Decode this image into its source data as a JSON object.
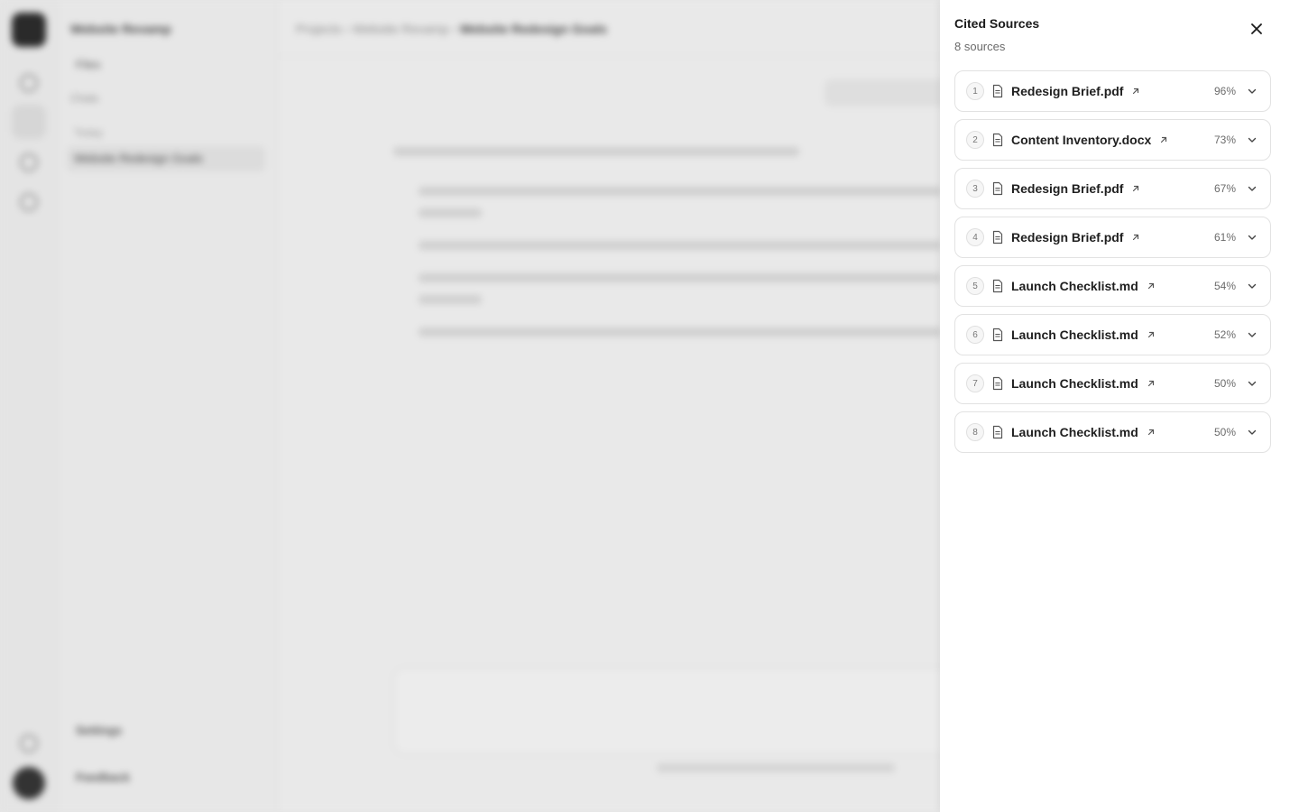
{
  "background": {
    "workspace_title": "Website Revamp",
    "files_label": "Files",
    "chats_label": "Chats",
    "today_label": "Today",
    "current_chat": "Website Redesign Goals",
    "settings_label": "Settings",
    "feedback_label": "Feedback",
    "breadcrumb": [
      "Projects",
      "Website Revamp",
      "Website Redesign Goals"
    ]
  },
  "drawer": {
    "title": "Cited Sources",
    "count": "8 sources",
    "sources": [
      {
        "index": "1",
        "name": "Redesign Brief.pdf",
        "score": "96%"
      },
      {
        "index": "2",
        "name": "Content Inventory.docx",
        "score": "73%"
      },
      {
        "index": "3",
        "name": "Redesign Brief.pdf",
        "score": "67%"
      },
      {
        "index": "4",
        "name": "Redesign Brief.pdf",
        "score": "61%"
      },
      {
        "index": "5",
        "name": "Launch Checklist.md",
        "score": "54%"
      },
      {
        "index": "6",
        "name": "Launch Checklist.md",
        "score": "52%"
      },
      {
        "index": "7",
        "name": "Launch Checklist.md",
        "score": "50%"
      },
      {
        "index": "8",
        "name": "Launch Checklist.md",
        "score": "50%"
      }
    ]
  },
  "icons": {
    "close": "close-icon",
    "document": "document-icon",
    "external": "external-link-icon",
    "expand": "chevron-down-icon"
  }
}
